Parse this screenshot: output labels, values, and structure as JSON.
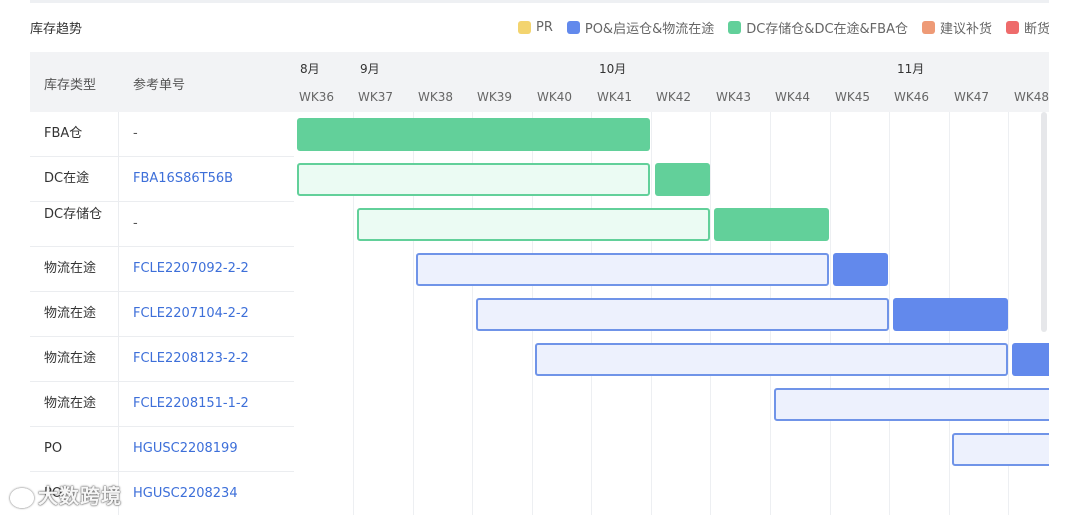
{
  "title": "库存趋势",
  "legend": [
    {
      "label": "PR",
      "color": "#f3d46f"
    },
    {
      "label": "PO&启运仓&物流在途",
      "color": "#6289ec"
    },
    {
      "label": "DC存储仓&DC在途&FBA仓",
      "color": "#62d09a"
    },
    {
      "label": "建议补货",
      "color": "#ee9a76"
    },
    {
      "label": "断货",
      "color": "#ee6b6b"
    }
  ],
  "columns": {
    "type": "库存类型",
    "ref": "参考单号"
  },
  "months": [
    "8月",
    "9月",
    "10月",
    "11月"
  ],
  "weeks": [
    "WK36",
    "WK37",
    "WK38",
    "WK39",
    "WK40",
    "WK41",
    "WK42",
    "WK43",
    "WK44",
    "WK45",
    "WK46",
    "WK47",
    "WK48"
  ],
  "rows": [
    {
      "type": "FBA仓",
      "ref": "-",
      "link": false
    },
    {
      "type": "DC在途",
      "ref": "FBA16S86T56B",
      "link": true
    },
    {
      "type": "DC存储仓",
      "ref": "-",
      "link": false
    },
    {
      "type": "物流在途",
      "ref": "FCLE2207092-2-2",
      "link": true
    },
    {
      "type": "物流在途",
      "ref": "FCLE2207104-2-2",
      "link": true
    },
    {
      "type": "物流在途",
      "ref": "FCLE2208123-2-2",
      "link": true
    },
    {
      "type": "物流在途",
      "ref": "FCLE2208151-1-2",
      "link": true
    },
    {
      "type": "PO",
      "ref": "HGUSC2208199",
      "link": true
    },
    {
      "type": "PO",
      "ref": "HGUSC2208234",
      "link": true
    }
  ],
  "watermark": "大数跨境"
}
